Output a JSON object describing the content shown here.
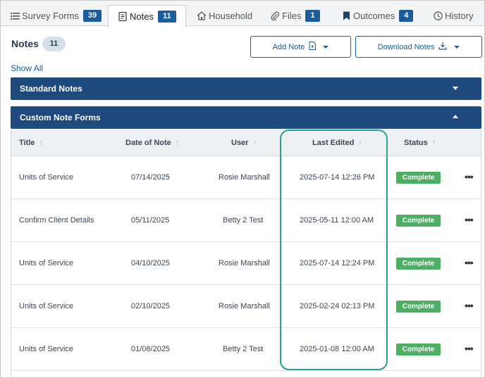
{
  "tabs": [
    {
      "label": "Survey Forms",
      "count": "39",
      "icon": "list-icon"
    },
    {
      "label": "Notes",
      "count": "11",
      "icon": "notebook-icon"
    },
    {
      "label": "Household",
      "icon": "house-icon"
    },
    {
      "label": "Files",
      "count": "1",
      "icon": "paperclip-icon"
    },
    {
      "label": "Outcomes",
      "count": "4",
      "icon": "bookmark-icon"
    },
    {
      "label": "History",
      "icon": "clock-icon"
    }
  ],
  "header": {
    "title": "Notes",
    "count": "11",
    "add_note_label": "Add Note",
    "download_notes_label": "Download Notes",
    "show_all": "Show All"
  },
  "sections": {
    "standard": "Standard Notes",
    "custom": "Custom Note Forms"
  },
  "table": {
    "columns": [
      "Title",
      "Date of Note",
      "User",
      "Last Edited",
      "Status"
    ],
    "rows": [
      {
        "title": "Units of Service",
        "date": "07/14/2025",
        "user": "Rosie Marshall",
        "last_edited": "2025-07-14 12:26 PM",
        "status": "Complete"
      },
      {
        "title": "Confirm Client Details",
        "date": "05/11/2025",
        "user": "Betty 2 Test",
        "last_edited": "2025-05-11 12:00 AM",
        "status": "Complete"
      },
      {
        "title": "Units of Service",
        "date": "04/10/2025",
        "user": "Rosie Marshall",
        "last_edited": "2025-07-14 12:24 PM",
        "status": "Complete"
      },
      {
        "title": "Units of Service",
        "date": "02/10/2025",
        "user": "Rosie Marshall",
        "last_edited": "2025-02-24 02:13 PM",
        "status": "Complete"
      },
      {
        "title": "Units of Service",
        "date": "01/08/2025",
        "user": "Betty 2 Test",
        "last_edited": "2025-01-08 12:00 AM",
        "status": "Complete"
      }
    ],
    "more_icon": "ellipsis-icon",
    "sort_icon": "sort-arrow-icon"
  },
  "colors": {
    "primary": "#1b5d9c",
    "section_bar": "#1f4a7e",
    "status_complete": "#4caf63",
    "highlight": "#2aa28b"
  }
}
